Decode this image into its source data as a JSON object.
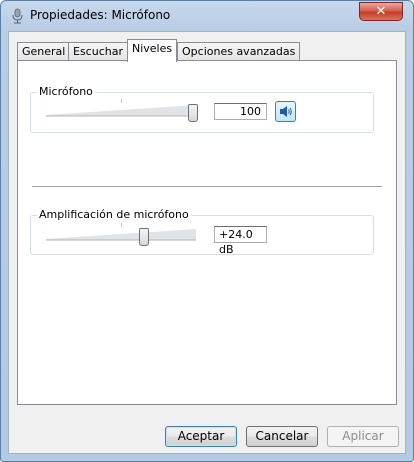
{
  "window": {
    "title": "Propiedades: Micrófono",
    "close_label": "✕"
  },
  "tabs": [
    {
      "label": "General"
    },
    {
      "label": "Escuchar"
    },
    {
      "label": "Niveles"
    },
    {
      "label": "Opciones avanzadas"
    }
  ],
  "active_tab": "Niveles",
  "levels": {
    "microphone": {
      "label": "Micrófono",
      "value_text": "100",
      "level_percent": 100,
      "mute_icon": "speaker-icon"
    },
    "boost": {
      "label": "Amplificación de micrófono",
      "value_text": "+24.0 dB",
      "level_fraction": 0.66
    }
  },
  "buttons": {
    "ok": "Aceptar",
    "cancel": "Cancelar",
    "apply": "Aplicar"
  },
  "colors": {
    "focus_blue": "#3c7fb1",
    "close_red": "#c33a26"
  }
}
